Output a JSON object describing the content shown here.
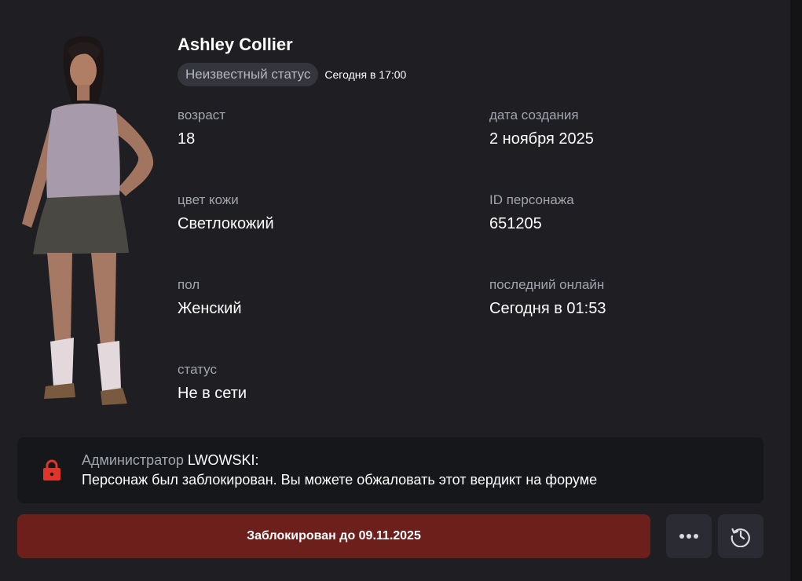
{
  "character": {
    "name": "Ashley Collier",
    "status_pill": "Неизвестный статус",
    "status_time": "Сегодня в 17:00"
  },
  "fields": {
    "age": {
      "label": "возраст",
      "value": "18"
    },
    "created": {
      "label": "дата создания",
      "value": "2 ноября 2025"
    },
    "skin": {
      "label": "цвет кожи",
      "value": "Светлокожий"
    },
    "char_id": {
      "label": "ID персонажа",
      "value": "651205"
    },
    "gender": {
      "label": "пол",
      "value": "Женский"
    },
    "last_online": {
      "label": "последний онлайн",
      "value": "Сегодня в 01:53"
    },
    "status": {
      "label": "статус",
      "value": "Не в сети"
    }
  },
  "ban": {
    "admin_prefix": "Администратор",
    "admin_name": "LWOWSKI:",
    "message": "Персонаж был заблокирован. Вы можете обжаловать этот вердикт на форуме",
    "lock_color": "#e0352b"
  },
  "actions": {
    "blocked_label": "Заблокирован до 09.11.2025",
    "more_icon": "more-icon",
    "history_icon": "history-icon"
  },
  "colors": {
    "background": "#1e1e23",
    "panel": "#16171b",
    "button_danger": "#6d1f1b",
    "button_neutral": "#2b2c33"
  }
}
